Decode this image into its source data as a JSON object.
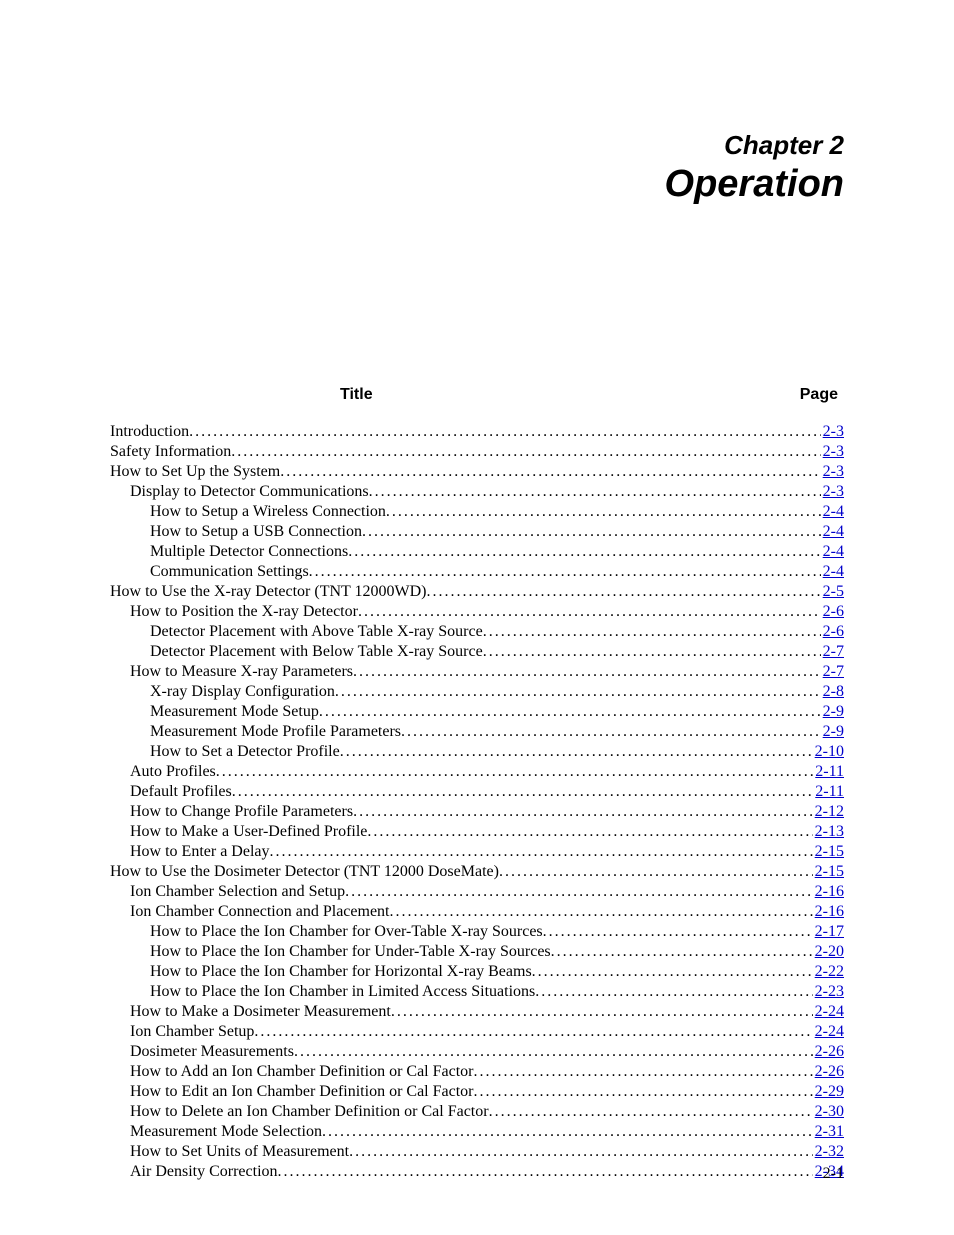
{
  "chapter": {
    "label": "Chapter 2",
    "title": "Operation"
  },
  "column_headers": {
    "title": "Title",
    "page": "Page"
  },
  "page_number": "2-1",
  "toc": [
    {
      "level": 0,
      "title": "Introduction",
      "page": "2-3"
    },
    {
      "level": 0,
      "title": "Safety Information",
      "page": "2-3"
    },
    {
      "level": 0,
      "title": "How to Set Up the System",
      "page": "2-3"
    },
    {
      "level": 1,
      "title": "Display to Detector Communications",
      "page": "2-3"
    },
    {
      "level": 2,
      "title": "How to Setup a Wireless Connection",
      "page": "2-4"
    },
    {
      "level": 2,
      "title": "How to Setup a USB Connection",
      "page": "2-4"
    },
    {
      "level": 2,
      "title": "Multiple Detector Connections",
      "page": "2-4"
    },
    {
      "level": 2,
      "title": "Communication Settings",
      "page": "2-4"
    },
    {
      "level": 0,
      "title": "How to Use the X-ray Detector (TNT 12000WD)",
      "page": "2-5"
    },
    {
      "level": 1,
      "title": "How to Position the X-ray Detector",
      "page": "2-6"
    },
    {
      "level": 2,
      "title": "Detector Placement with Above Table X-ray Source",
      "page": "2-6"
    },
    {
      "level": 2,
      "title": "Detector Placement with Below Table X-ray Source",
      "page": "2-7"
    },
    {
      "level": 1,
      "title": "How to Measure X-ray Parameters",
      "page": "2-7"
    },
    {
      "level": 2,
      "title": "X-ray Display Configuration",
      "page": "2-8"
    },
    {
      "level": 2,
      "title": "Measurement Mode Setup",
      "page": "2-9"
    },
    {
      "level": 2,
      "title": "Measurement Mode Profile Parameters",
      "page": "2-9"
    },
    {
      "level": 2,
      "title": "How to Set a Detector Profile",
      "page": "2-10"
    },
    {
      "level": 1,
      "title": "Auto Profiles",
      "page": "2-11"
    },
    {
      "level": 1,
      "title": "Default Profiles",
      "page": "2-11"
    },
    {
      "level": 1,
      "title": "How to Change Profile Parameters",
      "page": "2-12"
    },
    {
      "level": 1,
      "title": "How to Make a User-Defined Profile",
      "page": "2-13"
    },
    {
      "level": 1,
      "title": "How to Enter a Delay",
      "page": "2-15"
    },
    {
      "level": 0,
      "title": "How to Use the Dosimeter Detector (TNT 12000 DoseMate)",
      "page": "2-15"
    },
    {
      "level": 1,
      "title": "Ion Chamber Selection and Setup",
      "page": "2-16"
    },
    {
      "level": 1,
      "title": "Ion Chamber Connection and Placement",
      "page": "2-16"
    },
    {
      "level": 2,
      "title": "How to Place the Ion Chamber for Over-Table X-ray Sources",
      "page": "2-17"
    },
    {
      "level": 2,
      "title": "How to Place the Ion Chamber for Under-Table X-ray Sources",
      "page": "2-20"
    },
    {
      "level": 2,
      "title": "How to Place the Ion Chamber for Horizontal X-ray Beams",
      "page": "2-22"
    },
    {
      "level": 2,
      "title": "How to Place the Ion Chamber in Limited Access Situations",
      "page": "2-23"
    },
    {
      "level": 1,
      "title": "How to Make a Dosimeter Measurement",
      "page": "2-24"
    },
    {
      "level": 1,
      "title": "Ion Chamber Setup",
      "page": "2-24"
    },
    {
      "level": 1,
      "title": "Dosimeter Measurements",
      "page": "2-26"
    },
    {
      "level": 1,
      "title": "How to Add an Ion Chamber Definition or Cal Factor",
      "page": "2-26"
    },
    {
      "level": 1,
      "title": "How to Edit an Ion Chamber Definition or Cal Factor",
      "page": "2-29"
    },
    {
      "level": 1,
      "title": "How to Delete an Ion Chamber Definition or Cal Factor",
      "page": "2-30"
    },
    {
      "level": 1,
      "title": "Measurement Mode Selection",
      "page": "2-31"
    },
    {
      "level": 1,
      "title": "How to Set Units of Measurement",
      "page": "2-32"
    },
    {
      "level": 1,
      "title": "Air Density Correction",
      "page": "2-34"
    }
  ]
}
